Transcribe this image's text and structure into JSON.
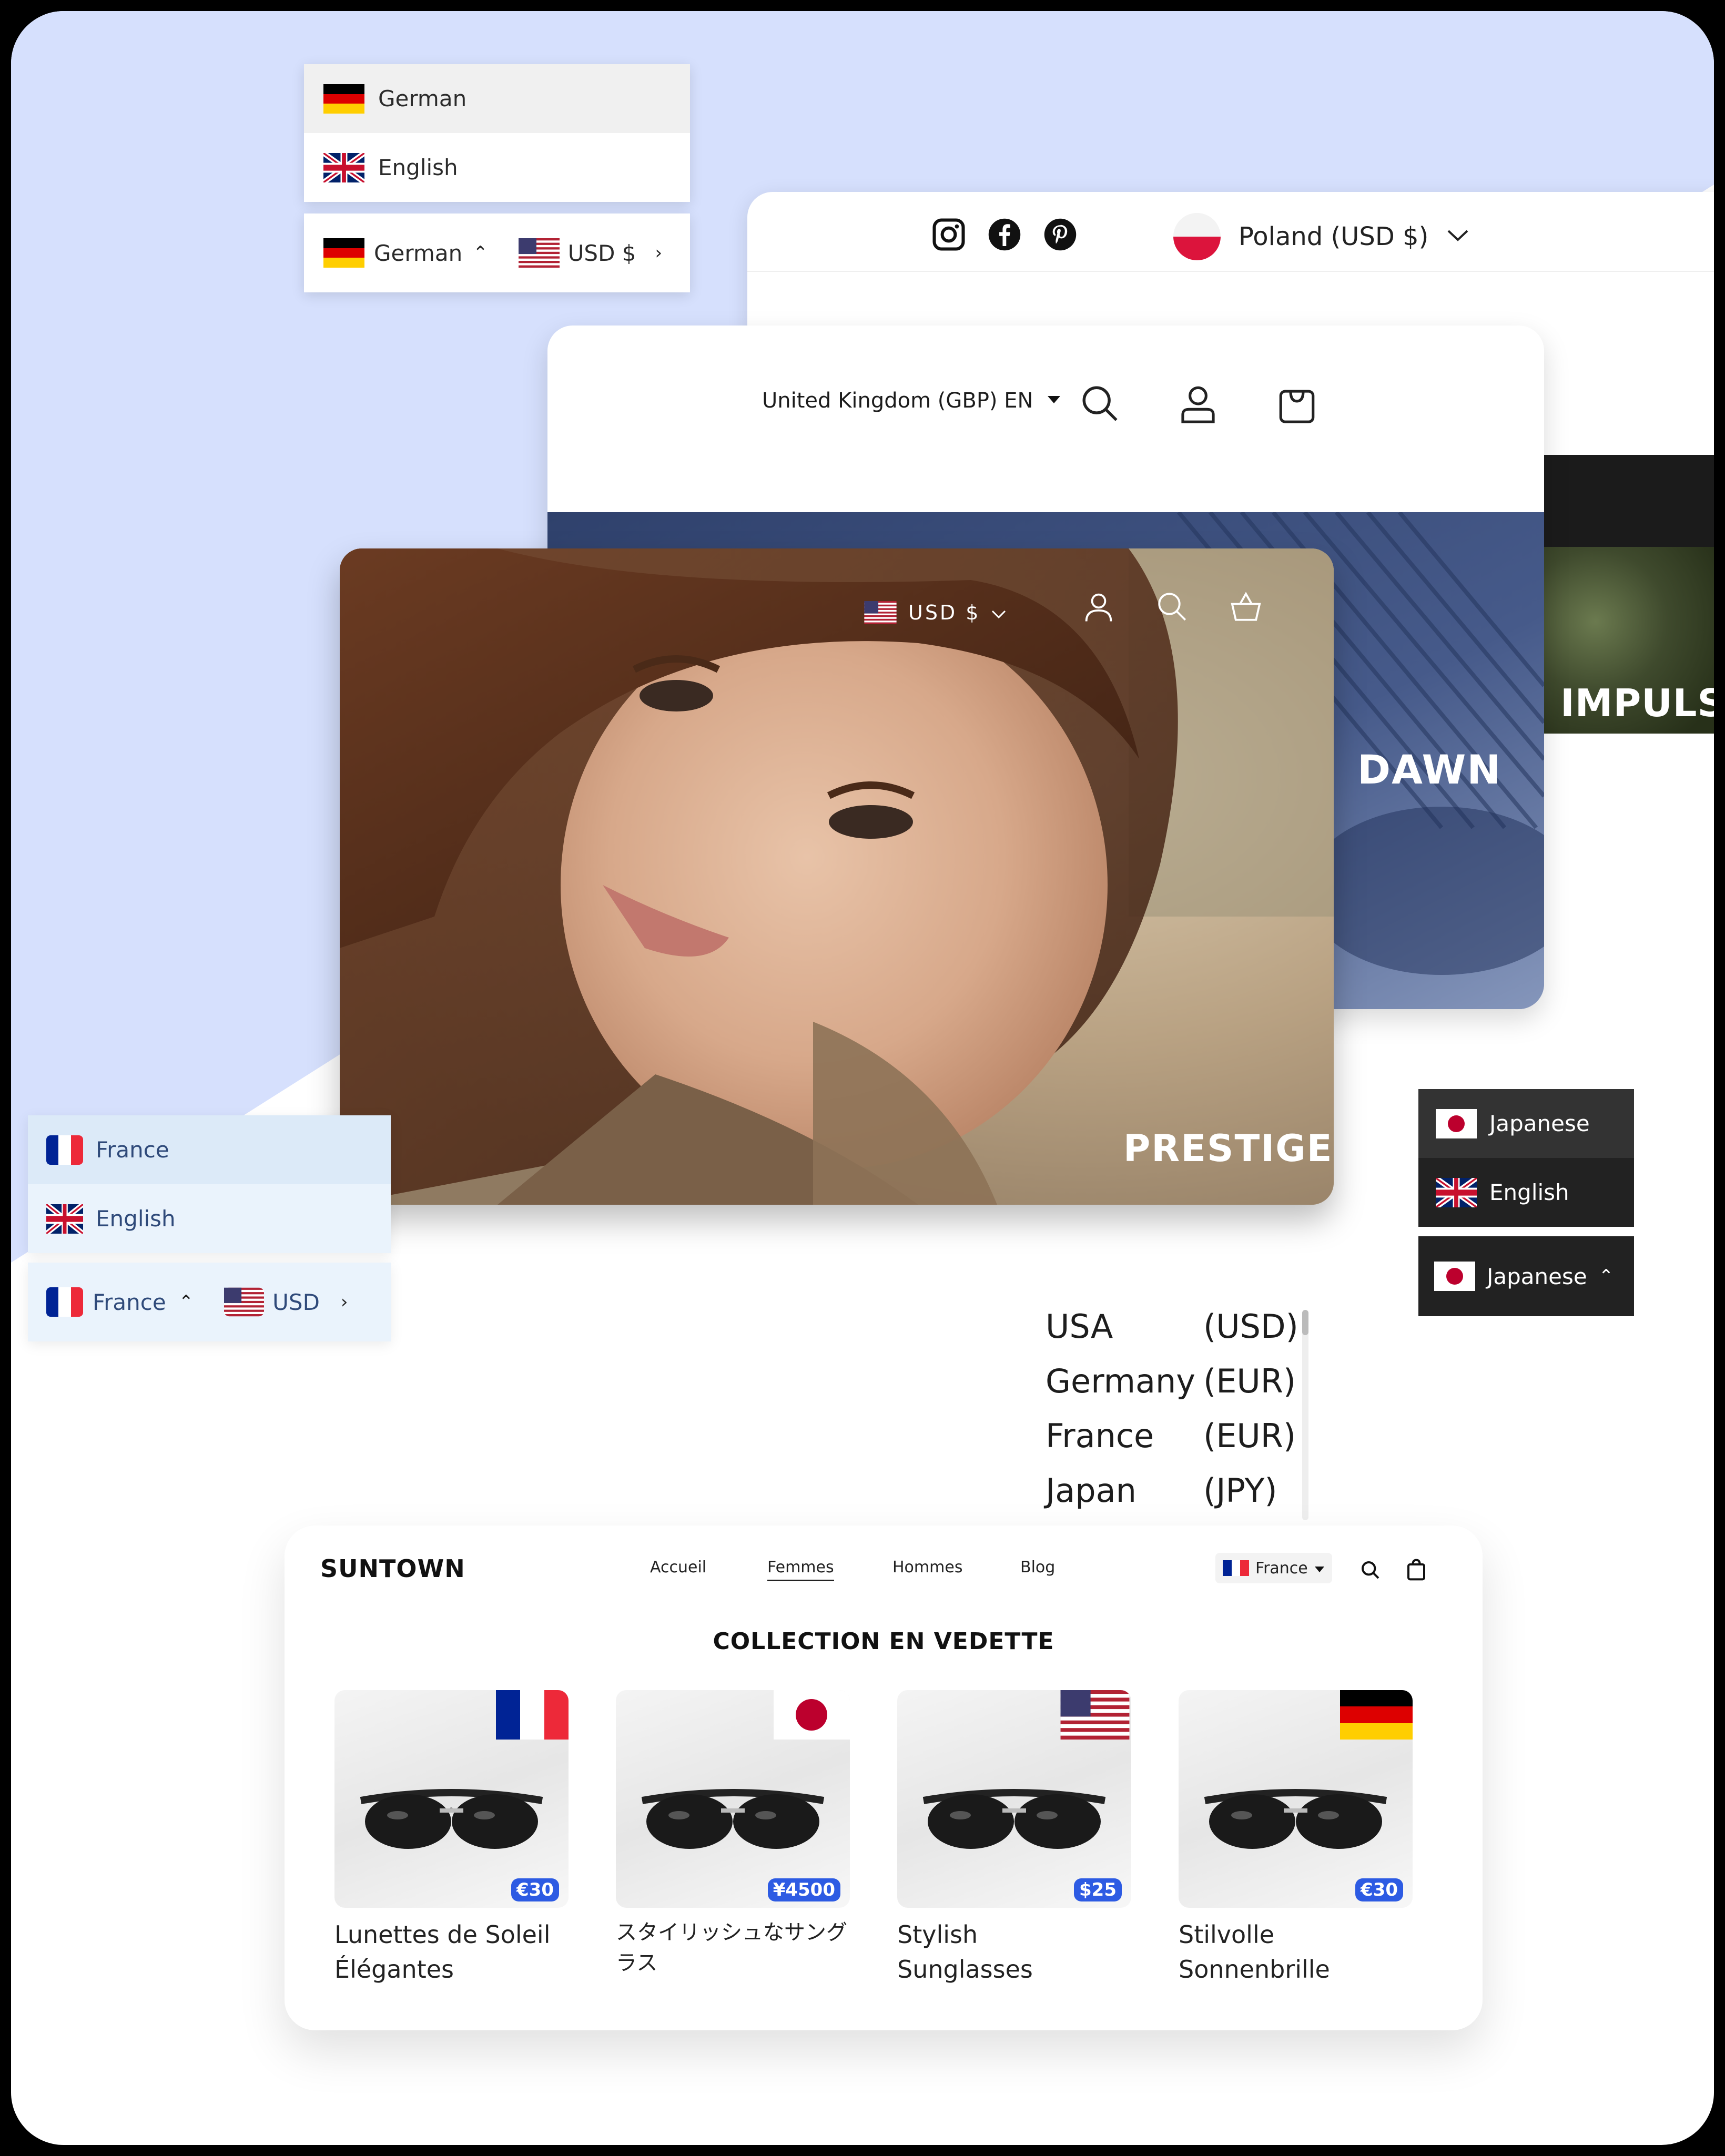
{
  "top_left_switcher": {
    "options": [
      {
        "flag": "germany-flag",
        "label": "German"
      },
      {
        "flag": "uk-flag",
        "label": "English"
      }
    ],
    "bar": {
      "language": "German",
      "currency": "USD $"
    }
  },
  "poland_header": {
    "social_icons": [
      "instagram-icon",
      "facebook-icon",
      "pinterest-icon"
    ],
    "country_selector": "Poland (USD $)"
  },
  "uk_header": {
    "selector": "United Kingdom (GBP) EN",
    "icons": [
      "search-icon",
      "account-icon",
      "bag-icon"
    ],
    "theme_label": "DAWN"
  },
  "impulse_card": {
    "theme_label": "IMPULSE"
  },
  "prestige_card": {
    "currency": "USD $",
    "icons": [
      "account-icon",
      "search-icon",
      "basket-icon"
    ],
    "theme_label": "PRESTIGE"
  },
  "france_switcher": {
    "options": [
      {
        "flag": "france-flag",
        "label": "France"
      },
      {
        "flag": "uk-flag",
        "label": "English"
      }
    ],
    "bar": {
      "language": "France",
      "currency": "USD"
    }
  },
  "japan_switcher": {
    "options": [
      {
        "flag": "japan-flag",
        "label": "Japanese"
      },
      {
        "flag": "uk-flag",
        "label": "English"
      }
    ],
    "bar": {
      "language": "Japanese"
    }
  },
  "currency_list": [
    {
      "country": "USA",
      "code": "(USD)"
    },
    {
      "country": "Germany",
      "code": "(EUR)"
    },
    {
      "country": "France",
      "code": "(EUR)"
    },
    {
      "country": "Japan",
      "code": "(JPY)"
    }
  ],
  "suntown": {
    "brand": "SUNTOWN",
    "nav": [
      "Accueil",
      "Femmes",
      "Hommes",
      "Blog"
    ],
    "active_nav": "Femmes",
    "country": "France",
    "section_title": "COLLECTION EN VEDETTE",
    "products": [
      {
        "name": "Lunettes de Soleil Élégantes",
        "price": "€30",
        "flag": "france-flag"
      },
      {
        "name": "スタイリッシュなサングラス",
        "price": "¥4500",
        "flag": "japan-flag"
      },
      {
        "name": "Stylish Sunglasses",
        "price": "$25",
        "flag": "usa-flag"
      },
      {
        "name": "Stilvolle Sonnenbrille",
        "price": "€30",
        "flag": "germany-flag"
      }
    ]
  },
  "colors": {
    "background_blue": "#d6e0fd",
    "price_badge": "#2d5be3",
    "dark_switcher": "#222222"
  }
}
